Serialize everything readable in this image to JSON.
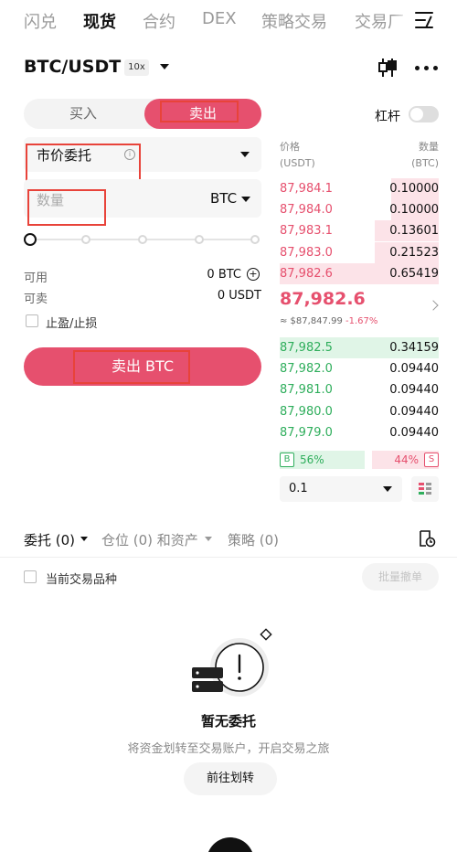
{
  "top_tabs": [
    "闪兑",
    "现货",
    "合约",
    "DEX",
    "策略交易",
    "交易厂"
  ],
  "pair": {
    "symbol": "BTC/USDT",
    "leverage": "10x"
  },
  "trade_side": {
    "buy": "买入",
    "sell": "卖出"
  },
  "leverage_toggle": {
    "label": "杠杆"
  },
  "order_type": {
    "label": "市价委托",
    "info": "i"
  },
  "quantity": {
    "placeholder": "数量",
    "unit": "BTC"
  },
  "slider": {
    "position_percent": 0,
    "steps": [
      0,
      25,
      50,
      75,
      100
    ]
  },
  "balances": {
    "available_label": "可用",
    "available_value": "0 BTC",
    "sellable_label": "可卖",
    "sellable_value": "0 USDT"
  },
  "tpsl": {
    "label": "止盈/止损"
  },
  "submit": {
    "label": "卖出 BTC"
  },
  "orderbook": {
    "price_header": "价格",
    "price_unit": "(USDT)",
    "qty_header": "数量",
    "qty_unit": "(BTC)",
    "asks": [
      {
        "price": "87,984.1",
        "qty": "0.10000",
        "depth": 0.3
      },
      {
        "price": "87,984.0",
        "qty": "0.10000",
        "depth": 0.3
      },
      {
        "price": "87,983.1",
        "qty": "0.13601",
        "depth": 0.4
      },
      {
        "price": "87,983.0",
        "qty": "0.21523",
        "depth": 0.4
      },
      {
        "price": "87,982.6",
        "qty": "0.65419",
        "depth": 1.0
      }
    ],
    "last_price": "87,982.6",
    "index_price": "≈ $87,847.99",
    "change": "-1.67%",
    "bids": [
      {
        "price": "87,982.5",
        "qty": "0.34159",
        "depth": 1.0
      },
      {
        "price": "87,982.0",
        "qty": "0.09440",
        "depth": 0.0
      },
      {
        "price": "87,981.0",
        "qty": "0.09440",
        "depth": 0.0
      },
      {
        "price": "87,980.0",
        "qty": "0.09440",
        "depth": 0.0
      },
      {
        "price": "87,979.0",
        "qty": "0.09440",
        "depth": 0.0
      }
    ],
    "ratio": {
      "buy_badge": "B",
      "buy_pct": "56%",
      "buy_fraction": 0.56,
      "sell_pct": "44%",
      "sell_badge": "S"
    },
    "depth_step": "0.1"
  },
  "bottom_tabs": [
    "委托 (0)",
    "仓位 (0) 和资产",
    "策略 (0)"
  ],
  "filter": {
    "current_pair_label": "当前交易品种",
    "batch_cancel": "批量撤单"
  },
  "empty_state": {
    "title": "暂无委托",
    "subtitle": "将资金划转至交易账户，开启交易之旅",
    "action": "前往划转"
  },
  "colors": {
    "sell": "#e6506e",
    "buy": "#2fae5c"
  }
}
